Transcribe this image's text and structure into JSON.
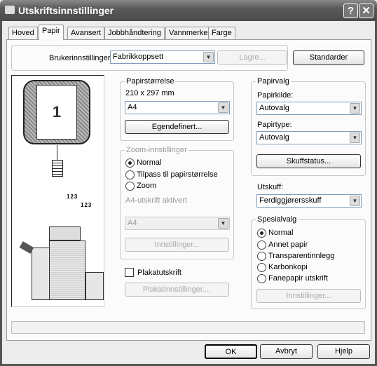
{
  "window": {
    "title": "Utskriftsinnstillinger",
    "help_label": "?",
    "close_label": "✕"
  },
  "tabs": [
    {
      "label": "Hoved"
    },
    {
      "label": "Papir",
      "active": true
    },
    {
      "label": "Avansert"
    },
    {
      "label": "Jobbhåndtering"
    },
    {
      "label": "Vannmerker"
    },
    {
      "label": "Farge"
    }
  ],
  "user_settings": {
    "label": "Brukerinnstillinger:",
    "value": "Fabrikkoppsett",
    "save_label": "Lagre...",
    "defaults_label": "Standarder"
  },
  "preview": {
    "page_number": "1",
    "sort_digits": [
      "1",
      "2",
      "3"
    ]
  },
  "paper_size": {
    "legend": "Papirstørrelse",
    "dimensions": "210 x 297 mm",
    "value": "A4",
    "custom_label": "Egendefinert..."
  },
  "zoom": {
    "legend": "Zoom-innstillinger",
    "options": [
      {
        "label": "Normal",
        "selected": true
      },
      {
        "label": "Tilpass til papirstørrelse",
        "selected": false
      },
      {
        "label": "Zoom",
        "selected": false
      }
    ],
    "a4_label": "A4-utskrift aktivert",
    "a4_value": "A4",
    "settings_label": "Innstillinger..."
  },
  "poster": {
    "checkbox_label": "Plakatutskrift",
    "checked": false,
    "settings_label": "Plakatinnstillinger...."
  },
  "paper_select": {
    "legend": "Papirvalg",
    "source_label": "Papirkilde:",
    "source_value": "Autovalg",
    "type_label": "Papirtype:",
    "type_value": "Autovalg",
    "tray_status_label": "Skuffstatus..."
  },
  "output": {
    "label": "Utskuff:",
    "value": "Ferdiggjørersskuff"
  },
  "special": {
    "legend": "Spesialvalg",
    "options": [
      {
        "label": "Normal",
        "selected": true
      },
      {
        "label": "Annet papir",
        "selected": false
      },
      {
        "label": "Transparentinnlegg",
        "selected": false
      },
      {
        "label": "Karbonkopi",
        "selected": false
      },
      {
        "label": "Fanepapir utskrift",
        "selected": false
      }
    ],
    "settings_label": "Innstillinger..."
  },
  "footer": {
    "ok_label": "OK",
    "cancel_label": "Avbryt",
    "help_label": "Hjelp"
  }
}
